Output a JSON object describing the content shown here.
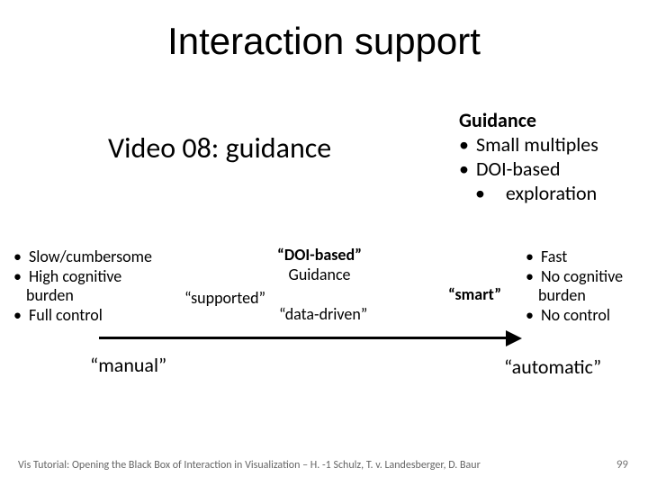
{
  "title": "Interaction support",
  "subtitle": "Video 08: guidance",
  "guidance": {
    "heading": "Guidance",
    "items": [
      "Small multiples",
      "DOI-based",
      "exploration"
    ]
  },
  "left": {
    "items": [
      "Slow/cumbersome",
      "High cognitive burden",
      "Full control"
    ]
  },
  "right": {
    "items": [
      "Fast",
      "No cognitive burden",
      "No control"
    ]
  },
  "axis": {
    "doibased_line1": "“DOI-based”",
    "doibased_line2": "Guidance",
    "supported": "“supported”",
    "datadriven": "“data-driven”",
    "smart": "“smart”",
    "manual": "“manual”",
    "automatic": "“automatic”"
  },
  "footer": "Vis Tutorial: Opening the Black Box of Interaction in Visualization – H. -1 Schulz, T. v. Landesberger, D. Baur",
  "pagenum": "99"
}
